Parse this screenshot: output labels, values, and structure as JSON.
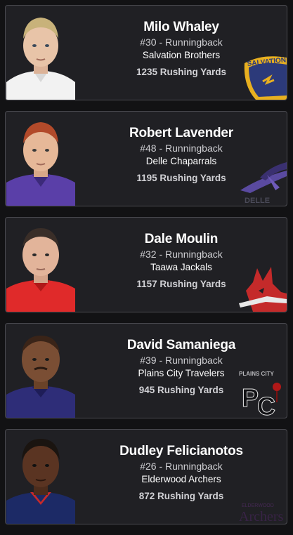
{
  "players": [
    {
      "name": "Milo Whaley",
      "number_position": "#30 - Runningback",
      "team": "Salvation Brothers",
      "stat": "1235 Rushing Yards",
      "jersey_color": "#f2f2f2",
      "hair_color": "#c8b27a",
      "skin_color": "#e8c4a8",
      "logo": "salvation-brothers-logo",
      "logo_text": "SALVATION"
    },
    {
      "name": "Robert Lavender",
      "number_position": "#48 - Runningback",
      "team": "Delle Chaparrals",
      "stat": "1195 Rushing Yards",
      "jersey_color": "#5a3fa8",
      "hair_color": "#b24a2a",
      "skin_color": "#e6b898",
      "logo": "delle-chaparrals-logo",
      "logo_text": "DELLE"
    },
    {
      "name": "Dale Moulin",
      "number_position": "#32 - Runningback",
      "team": "Taawa Jackals",
      "stat": "1157 Rushing Yards",
      "jersey_color": "#e02a2a",
      "hair_color": "#3a2e28",
      "skin_color": "#e2b49a",
      "logo": "taawa-jackals-logo",
      "logo_text": ""
    },
    {
      "name": "David Samaniega",
      "number_position": "#39 - Runningback",
      "team": "Plains City Travelers",
      "stat": "945 Rushing Yards",
      "jersey_color": "#2e2d78",
      "hair_color": "#3a2418",
      "skin_color": "#7a4e34",
      "logo": "plains-city-travelers-logo",
      "logo_text": "PLAINS CITY"
    },
    {
      "name": "Dudley Felicianotos",
      "number_position": "#26 - Runningback",
      "team": "Elderwood Archers",
      "stat": "872 Rushing Yards",
      "jersey_color": "#1c2a66",
      "hair_color": "#1a1410",
      "skin_color": "#5a3422",
      "logo": "elderwood-archers-logo",
      "logo_text": "ELDERWOOD Archers"
    }
  ]
}
